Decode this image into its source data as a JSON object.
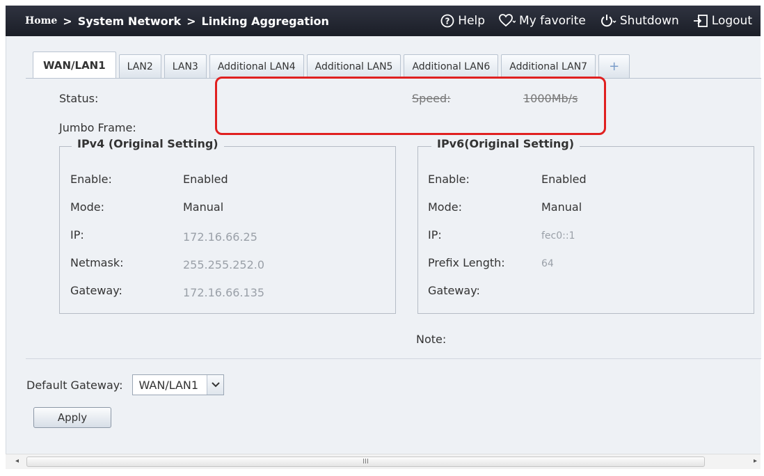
{
  "breadcrumb": {
    "home": "Home",
    "sep1": ">",
    "section": "System Network",
    "sep2": ">",
    "page": "Linking Aggregation"
  },
  "top_actions": {
    "help": "Help",
    "favorite": "My favorite",
    "shutdown": "Shutdown",
    "logout": "Logout"
  },
  "tabs": [
    {
      "label": "WAN/LAN1",
      "active": true
    },
    {
      "label": "LAN2"
    },
    {
      "label": "LAN3"
    },
    {
      "label": "Additional LAN4"
    },
    {
      "label": "Additional LAN5"
    },
    {
      "label": "Additional LAN6"
    },
    {
      "label": "Additional LAN7"
    },
    {
      "label": "+"
    }
  ],
  "status": {
    "status_label": "Status:",
    "speed_label": "Speed:",
    "speed_value": "1000Mb/s",
    "jumbo_label": "Jumbo Frame:"
  },
  "ipv4": {
    "title": "IPv4 (Original Setting)",
    "enable_label": "Enable:",
    "enable_value": "Enabled",
    "mode_label": "Mode:",
    "mode_value": "Manual",
    "ip_label": "IP:",
    "ip_value": "172.16.66.25",
    "netmask_label": "Netmask:",
    "netmask_value": "255.255.252.0",
    "gateway_label": "Gateway:",
    "gateway_value": "172.16.66.135"
  },
  "ipv6": {
    "title": "IPv6(Original Setting)",
    "enable_label": "Enable:",
    "enable_value": "Enabled",
    "mode_label": "Mode:",
    "mode_value": "Manual",
    "ip_label": "IP:",
    "ip_value": "fec0::1",
    "prefix_label": "Prefix Length:",
    "prefix_value": "64",
    "gateway_label": "Gateway:"
  },
  "note_label": "Note:",
  "default_gateway": {
    "label": "Default Gateway:",
    "selected": "WAN/LAN1"
  },
  "apply_label": "Apply",
  "scrollbar": {
    "left_arrow": "◂",
    "right_arrow": "▸",
    "grip": "III"
  },
  "colors": {
    "topbar": "#1b1e27",
    "panel": "#eef1f5",
    "highlight": "#e02020"
  }
}
